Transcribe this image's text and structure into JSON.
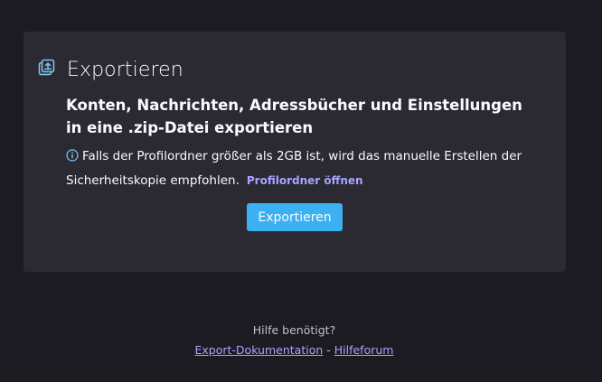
{
  "card": {
    "icon": "export-icon",
    "title": "Exportieren",
    "subtitle": "Konten, Nachrichten, Adressbücher und Einstellungen in eine .zip-Datei exportieren",
    "info_icon": "info-icon",
    "info_text": "Falls der Profilordner größer als 2GB ist, wird das manuelle Erstellen der Sicherheitskopie empfohlen.",
    "open_profile_link": "Profilordner öffnen",
    "export_button": "Exportieren"
  },
  "help": {
    "prompt": "Hilfe benötigt?",
    "doc_link": "Export-Dokumentation",
    "separator": " - ",
    "forum_link": "Hilfeforum"
  },
  "colors": {
    "background": "#1c1b22",
    "card": "#2b2a33",
    "accent_button": "#3bb0f2",
    "link": "#a8a4ff",
    "icon": "#80c7f7"
  }
}
